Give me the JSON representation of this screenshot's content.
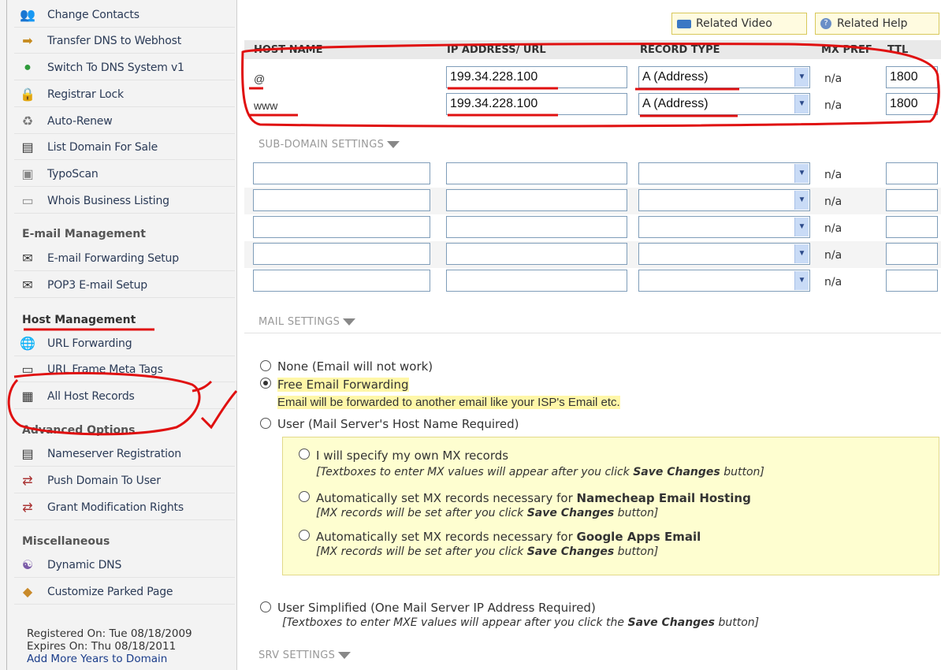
{
  "sidebar": {
    "items": [
      {
        "label": "Change Contacts",
        "icon": "contacts-icon",
        "glyph": "👥"
      },
      {
        "label": "Transfer DNS to Webhost",
        "icon": "arrow-right-icon",
        "glyph": "➡"
      },
      {
        "label": "Switch To DNS System v1",
        "icon": "switch-icon",
        "glyph": "●"
      },
      {
        "label": "Registrar Lock",
        "icon": "lock-icon",
        "glyph": "🔒"
      },
      {
        "label": "Auto-Renew",
        "icon": "auto-renew-icon",
        "glyph": "♻"
      },
      {
        "label": "List Domain For Sale",
        "icon": "list-icon",
        "glyph": "▤"
      },
      {
        "label": "TypoScan",
        "icon": "typoscan-icon",
        "glyph": "▣"
      },
      {
        "label": "Whois Business Listing",
        "icon": "whois-icon",
        "glyph": "▭"
      }
    ],
    "email_heading": "E-mail Management",
    "email_items": [
      {
        "label": "E-mail Forwarding Setup",
        "icon": "email-forward-icon",
        "glyph": "✉"
      },
      {
        "label": "POP3 E-mail Setup",
        "icon": "envelope-icon",
        "glyph": "✉"
      }
    ],
    "host_heading": "Host Management",
    "host_items": [
      {
        "label": "URL Forwarding",
        "icon": "globe-icon",
        "glyph": "🌐"
      },
      {
        "label": "URL Frame Meta Tags",
        "icon": "frame-icon",
        "glyph": "▭"
      },
      {
        "label": "All Host Records",
        "icon": "host-records-icon",
        "glyph": "▦"
      }
    ],
    "advanced_heading": "Advanced Options",
    "advanced_items": [
      {
        "label": "Nameserver Registration",
        "icon": "nameserver-icon",
        "glyph": "▤"
      },
      {
        "label": "Push Domain To User",
        "icon": "push-icon",
        "glyph": "⇄"
      },
      {
        "label": "Grant Modification Rights",
        "icon": "grant-icon",
        "glyph": "⇄"
      }
    ],
    "misc_heading": "Miscellaneous",
    "misc_items": [
      {
        "label": "Dynamic DNS",
        "icon": "dynamic-dns-icon",
        "glyph": "☯"
      },
      {
        "label": "Customize Parked Page",
        "icon": "parked-page-icon",
        "glyph": "◆"
      }
    ],
    "registered": "Registered On: Tue 08/18/2009",
    "expires": "Expires On: Thu 08/18/2011",
    "add_years": "Add More Years to Domain"
  },
  "toolbar": {
    "related_video": "Related Video",
    "related_help": "Related Help"
  },
  "host_table": {
    "headers": {
      "host": "HOST NAME",
      "ip": "IP ADDRESS/ URL",
      "type": "RECORD TYPE",
      "mx": "MX PREF",
      "ttl": "TTL"
    },
    "rows": [
      {
        "host": "@",
        "ip": "199.34.228.100",
        "type": "A (Address)",
        "mx": "n/a",
        "ttl": "1800"
      },
      {
        "host": "www",
        "ip": "199.34.228.100",
        "type": "A (Address)",
        "mx": "n/a",
        "ttl": "1800"
      }
    ]
  },
  "subdomain": {
    "label": "SUB-DOMAIN SETTINGS",
    "rows": [
      {
        "mx": "n/a"
      },
      {
        "mx": "n/a"
      },
      {
        "mx": "n/a"
      },
      {
        "mx": "n/a"
      },
      {
        "mx": "n/a"
      }
    ]
  },
  "mail": {
    "label": "MAIL SETTINGS",
    "none": "None (Email will not work)",
    "free_forwarding": "Free Email Forwarding",
    "free_note": "Email will be forwarded to another email like your ISP's Email etc.",
    "user": "User (Mail Server's Host Name Required)",
    "opt1": "I will specify my own MX records",
    "opt1_note_pre": "[Textboxes to enter MX values will appear after you click ",
    "opt1_note_bold": "Save Changes",
    "opt1_note_post": " button]",
    "opt2_pre": "Automatically set MX records necessary for ",
    "opt2_bold": "Namecheap Email Hosting",
    "opt2_note_pre": "[MX records will be set after you click ",
    "opt2_note_bold": "Save Changes",
    "opt2_note_post": " button]",
    "opt3_pre": "Automatically set MX records necessary for ",
    "opt3_bold": "Google Apps Email",
    "opt3_note_pre": "[MX records will be set after you click ",
    "opt3_note_bold": "Save Changes",
    "opt3_note_post": " button]",
    "simplified": "User Simplified (One Mail Server IP Address Required)",
    "simplified_note_pre": "[Textboxes to enter MXE values will appear after you click the ",
    "simplified_note_bold": "Save Changes",
    "simplified_note_post": " button]"
  },
  "srv": {
    "label": "SRV SETTINGS"
  },
  "colors": {
    "annotation": "#e01010",
    "link": "#1a3c8a",
    "highlight": "#fff7a8"
  }
}
